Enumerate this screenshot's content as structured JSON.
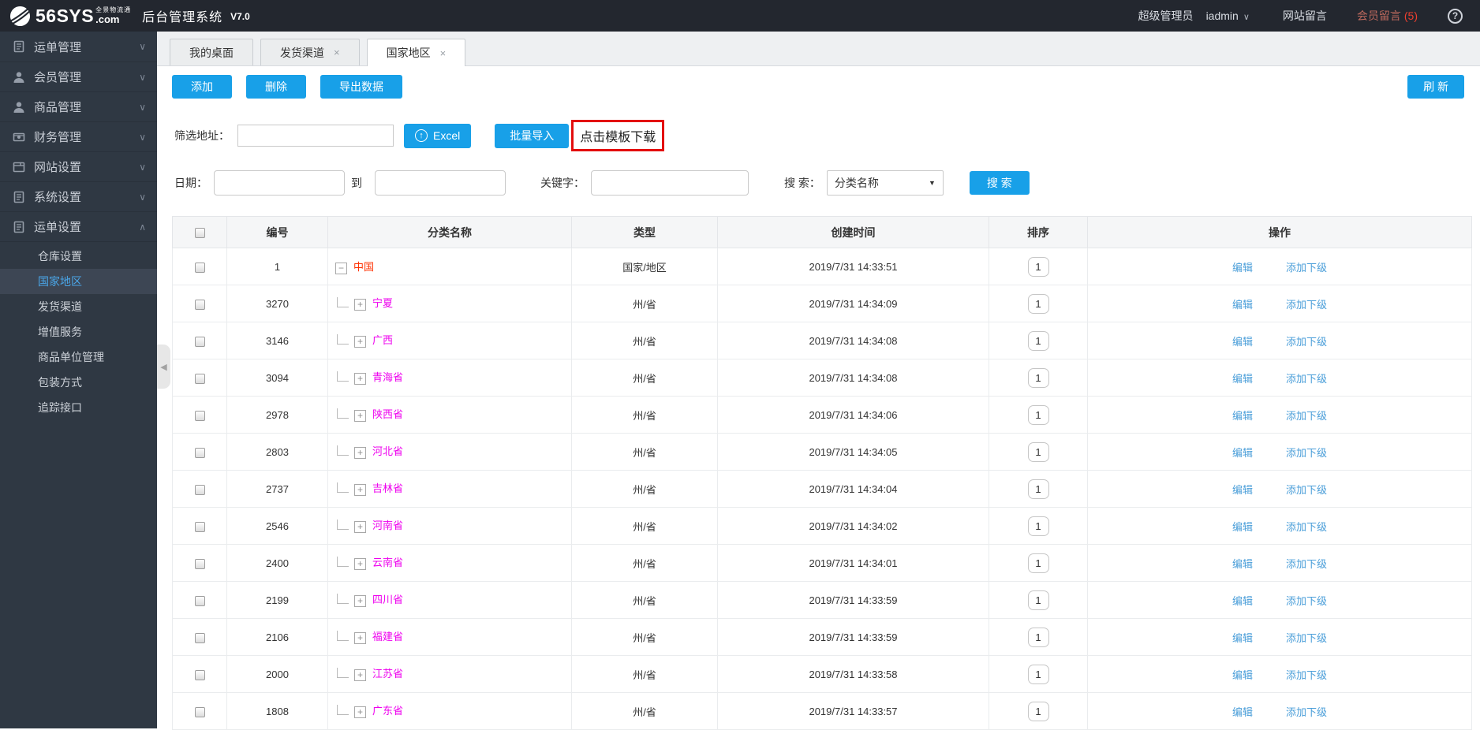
{
  "topbar": {
    "logo_text": "56SYS",
    "logo_tagline": "全景物流通",
    "logo_suffix": ".com",
    "system_name": "后台管理系统",
    "version": "V7.0",
    "role": "超级管理员",
    "username": "iadmin",
    "site_messages": "网站留言",
    "member_messages": "会员留言",
    "member_message_count": "(5)",
    "help": "?"
  },
  "sidebar": {
    "menu": [
      {
        "label": "运单管理",
        "icon": "doc-icon"
      },
      {
        "label": "会员管理",
        "icon": "user-icon"
      },
      {
        "label": "商品管理",
        "icon": "user-icon"
      },
      {
        "label": "财务管理",
        "icon": "money-icon"
      },
      {
        "label": "网站设置",
        "icon": "window-icon"
      },
      {
        "label": "系统设置",
        "icon": "doc-icon"
      },
      {
        "label": "运单设置",
        "icon": "doc-icon",
        "expanded": true
      }
    ],
    "submenu": [
      {
        "label": "仓库设置",
        "active": false
      },
      {
        "label": "国家地区",
        "active": true
      },
      {
        "label": "发货渠道",
        "active": false
      },
      {
        "label": "增值服务",
        "active": false
      },
      {
        "label": "商品单位管理",
        "active": false
      },
      {
        "label": "包装方式",
        "active": false
      },
      {
        "label": "追踪接口",
        "active": false
      }
    ]
  },
  "tabs": [
    {
      "label": "我的桌面",
      "closable": false,
      "active": false
    },
    {
      "label": "发货渠道",
      "closable": true,
      "active": false
    },
    {
      "label": "国家地区",
      "closable": true,
      "active": true
    }
  ],
  "toolbar": {
    "add": "添加",
    "delete": "删除",
    "export": "导出数据",
    "refresh": "刷 新"
  },
  "filters": {
    "address_label": "筛选地址：",
    "excel_button": "Excel",
    "import_button": "批量导入",
    "template_link": "点击模板下载",
    "date_label": "日期：",
    "to_label": "到",
    "keyword_label": "关键字：",
    "search_label": "搜 索：",
    "search_select_value": "分类名称",
    "search_button": "搜 索"
  },
  "table": {
    "headers": [
      "编号",
      "分类名称",
      "类型",
      "创建时间",
      "排序",
      "操作"
    ],
    "edit_label": "编辑",
    "add_child_label": "添加下级",
    "rows": [
      {
        "id": "1",
        "name": "中国",
        "level": "root",
        "type": "国家/地区",
        "created": "2019/7/31 14:33:51",
        "sort": "1"
      },
      {
        "id": "3270",
        "name": "宁夏",
        "level": "province",
        "type": "州/省",
        "created": "2019/7/31 14:34:09",
        "sort": "1"
      },
      {
        "id": "3146",
        "name": "广西",
        "level": "province",
        "type": "州/省",
        "created": "2019/7/31 14:34:08",
        "sort": "1"
      },
      {
        "id": "3094",
        "name": "青海省",
        "level": "province",
        "type": "州/省",
        "created": "2019/7/31 14:34:08",
        "sort": "1"
      },
      {
        "id": "2978",
        "name": "陕西省",
        "level": "province",
        "type": "州/省",
        "created": "2019/7/31 14:34:06",
        "sort": "1"
      },
      {
        "id": "2803",
        "name": "河北省",
        "level": "province",
        "type": "州/省",
        "created": "2019/7/31 14:34:05",
        "sort": "1"
      },
      {
        "id": "2737",
        "name": "吉林省",
        "level": "province",
        "type": "州/省",
        "created": "2019/7/31 14:34:04",
        "sort": "1"
      },
      {
        "id": "2546",
        "name": "河南省",
        "level": "province",
        "type": "州/省",
        "created": "2019/7/31 14:34:02",
        "sort": "1"
      },
      {
        "id": "2400",
        "name": "云南省",
        "level": "province",
        "type": "州/省",
        "created": "2019/7/31 14:34:01",
        "sort": "1"
      },
      {
        "id": "2199",
        "name": "四川省",
        "level": "province",
        "type": "州/省",
        "created": "2019/7/31 14:33:59",
        "sort": "1"
      },
      {
        "id": "2106",
        "name": "福建省",
        "level": "province",
        "type": "州/省",
        "created": "2019/7/31 14:33:59",
        "sort": "1"
      },
      {
        "id": "2000",
        "name": "江苏省",
        "level": "province",
        "type": "州/省",
        "created": "2019/7/31 14:33:58",
        "sort": "1"
      },
      {
        "id": "1808",
        "name": "广东省",
        "level": "province",
        "type": "州/省",
        "created": "2019/7/31 14:33:57",
        "sort": "1"
      }
    ]
  },
  "colors": {
    "accent_blue": "#18a0e8",
    "link_blue": "#4a9ed9",
    "root_red": "#ff3000",
    "province_magenta": "#ee00ee",
    "highlight_red": "#e30d0d",
    "topbar_bg": "#23272f",
    "sidebar_bg": "#2f3843"
  }
}
